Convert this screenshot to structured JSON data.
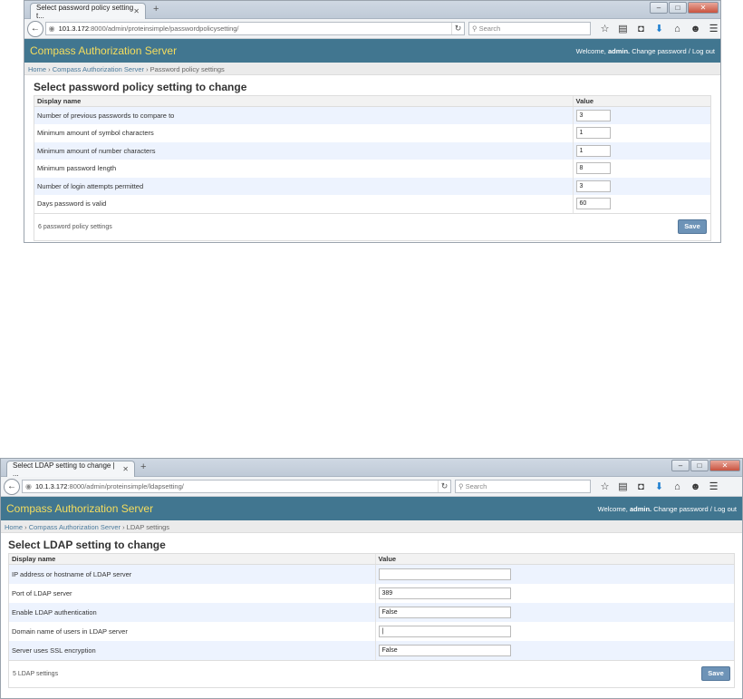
{
  "window1": {
    "tab_title": "Select password policy setting t...",
    "url_host": "101.3.172",
    "url_path": ":8000/admin/proteinsimple/passwordpolicysetting/",
    "search_placeholder": "Search",
    "brand": "Compass Authorization Server",
    "welcome": "Welcome,",
    "user": "admin.",
    "change_password": "Change password",
    "separator": "/",
    "logout": "Log out",
    "crumb_home": "Home",
    "crumb_app": "Compass Authorization Server",
    "crumb_current": "Password policy settings",
    "title": "Select password policy setting to change",
    "col_name": "Display name",
    "col_value": "Value",
    "rows": [
      {
        "name": "Number of previous passwords to compare to",
        "value": "3"
      },
      {
        "name": "Minimum amount of symbol characters",
        "value": "1"
      },
      {
        "name": "Minimum amount of number characters",
        "value": "1"
      },
      {
        "name": "Minimum password length",
        "value": "8"
      },
      {
        "name": "Number of login attempts permitted",
        "value": "3"
      },
      {
        "name": "Days password is valid",
        "value": "60"
      }
    ],
    "count_text": "6 password policy settings",
    "save_label": "Save"
  },
  "window2": {
    "tab_title": "Select LDAP setting to change | ...",
    "url_host": "10.1.3.172",
    "url_path": ":8000/admin/proteinsimple/ldapsetting/",
    "search_placeholder": "Search",
    "brand": "Compass Authorization Server",
    "welcome": "Welcome,",
    "user": "admin.",
    "change_password": "Change password",
    "separator": "/",
    "logout": "Log out",
    "crumb_home": "Home",
    "crumb_app": "Compass Authorization Server",
    "crumb_current": "LDAP settings",
    "title": "Select LDAP setting to change",
    "col_name": "Display name",
    "col_value": "Value",
    "rows": [
      {
        "name": "IP address or hostname of LDAP server",
        "value": ""
      },
      {
        "name": "Port of LDAP server",
        "value": "389"
      },
      {
        "name": "Enable LDAP authentication",
        "value": "False"
      },
      {
        "name": "Domain name of users in LDAP server",
        "value": "|"
      },
      {
        "name": "Server uses SSL encryption",
        "value": "False"
      }
    ],
    "count_text": "5 LDAP settings",
    "save_label": "Save"
  },
  "icons": {
    "back": "back-arrow-icon",
    "lock": "site-info-icon",
    "reload": "reload-icon",
    "search": "search-icon",
    "bookmark": "bookmark-star-icon",
    "library": "library-icon",
    "pocket": "pocket-icon",
    "download": "download-icon",
    "home": "home-icon",
    "chat": "chat-icon",
    "menu": "menu-icon"
  },
  "colors": {
    "header_bg": "#417690",
    "brand_text": "#f5dd5d",
    "save_bg": "#6d93b7",
    "alt_row": "#edf3fe"
  }
}
